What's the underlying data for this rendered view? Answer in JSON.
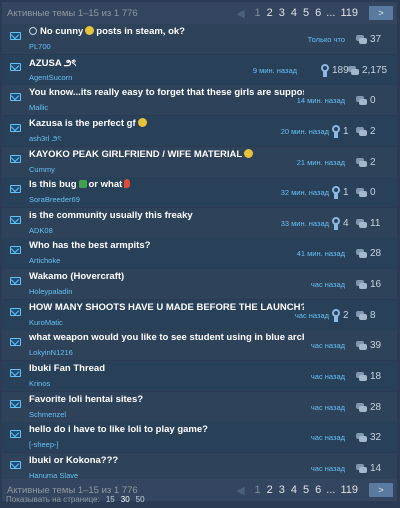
{
  "pagination": {
    "summary": "Активные темы 1–15 из 1 776",
    "pages": [
      "1",
      "2",
      "3",
      "4",
      "5",
      "6"
    ],
    "active_page": "1",
    "ellipsis": "...",
    "last_page": "119",
    "prev_icon": "left-arrow",
    "next_icon": "right-arrow"
  },
  "topics": [
    {
      "title": "No cunny",
      "title_suffix": "posts in steam, ok?",
      "emoji": "smile",
      "verified": true,
      "author": "PL700",
      "time": "Только что",
      "awards": "",
      "replies": "37"
    },
    {
      "title": "AZUSA ౨ৎ",
      "author": "AgentSucorn",
      "time": "9 мин. назад",
      "awards": "189",
      "replies": "2,175"
    },
    {
      "title": "You know...its really easy to forget that these girls are suppose...",
      "author": "Mallic",
      "time": "14 мин. назад",
      "awards": "",
      "replies": "0"
    },
    {
      "title": "Kazusa is the perfect gf",
      "emoji": "smile",
      "author": "ash3rl ౨ৎ",
      "time": "20 мин. назад",
      "awards": "1",
      "replies": "2"
    },
    {
      "title": "KAYOKO PEAK GIRLFRIEND / WIFE MATERIAL",
      "emoji": "smile",
      "author": "Cummy",
      "time": "21 мин. назад",
      "awards": "",
      "replies": "2"
    },
    {
      "title": "Is this bug",
      "title_suffix": "or what",
      "emoji": "boot",
      "emoji2": "pin",
      "author": "SoraBreeder69",
      "time": "32 мин. назад",
      "awards": "1",
      "replies": "0"
    },
    {
      "title": "is the community usually this freaky",
      "author": "ADK08",
      "time": "33 мин. назад",
      "awards": "4",
      "replies": "11"
    },
    {
      "title": "Who has the best armpits?",
      "author": "Artichoke",
      "time": "41 мин. назад",
      "awards": "",
      "replies": "28"
    },
    {
      "title": "Wakamo (Hovercraft)",
      "author": "Holeypaladin",
      "time": "час назад",
      "awards": "",
      "replies": "16"
    },
    {
      "title": "HOW MANY SHOOTS HAVE U MADE BEFORE THE LAUNCH????!!!",
      "author": "KuroMatic",
      "time": "час назад",
      "awards": "2",
      "replies": "8"
    },
    {
      "title": "what weapon would you like to see student using in blue archive",
      "author": "LokyinN1216",
      "time": "час назад",
      "awards": "",
      "replies": "39"
    },
    {
      "title": "Ibuki Fan Thread",
      "author": "Krinos",
      "time": "час назад",
      "awards": "",
      "replies": "18"
    },
    {
      "title": "Favorite loli hentai sites?",
      "author": "Schmenzel",
      "time": "час назад",
      "awards": "",
      "replies": "28"
    },
    {
      "title": "hello do i have to like loli to play game?",
      "author": "[-sheep-]",
      "time": "час назад",
      "awards": "",
      "replies": "32"
    },
    {
      "title": "Ibuki or Kokona???",
      "author": "Hanuma Slave",
      "time": "час назад",
      "awards": "",
      "replies": "14"
    }
  ],
  "footer": {
    "label": "Показывать на странице:",
    "options": [
      "15",
      "30",
      "50"
    ],
    "active": "15"
  },
  "colors": {
    "accent": "#66c0f4",
    "background": "#2b3b53",
    "bar": "#34465f"
  }
}
